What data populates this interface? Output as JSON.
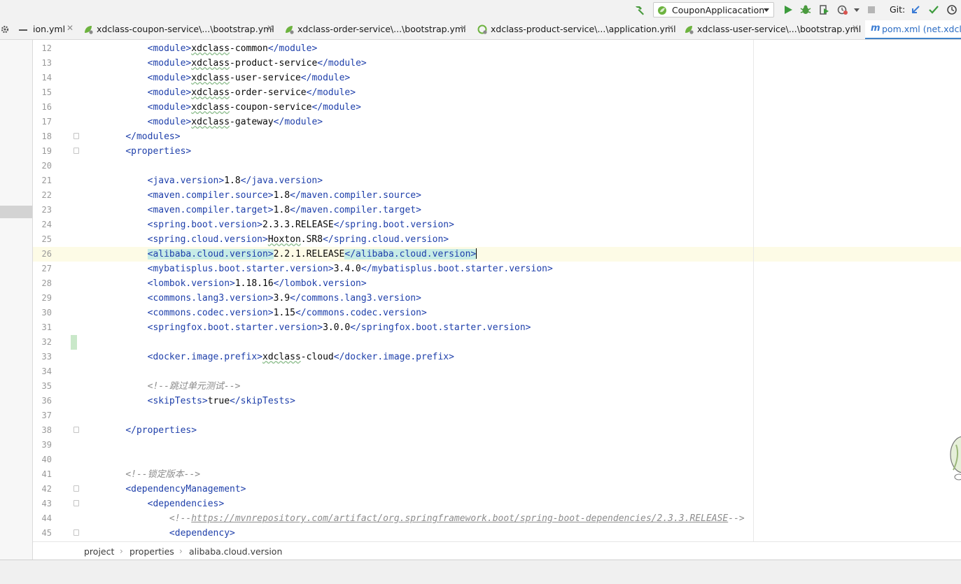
{
  "toolbar": {
    "run_config": "CouponApplicacation",
    "git_label": "Git:"
  },
  "tabs": [
    {
      "label": "ion.yml",
      "icon": "yaml-icon",
      "active": false
    },
    {
      "label": "xdclass-coupon-service\\...\\bootstrap.yml",
      "icon": "spring-leaf-icon",
      "active": false
    },
    {
      "label": "xdclass-order-service\\...\\bootstrap.yml",
      "icon": "spring-leaf-icon",
      "active": false
    },
    {
      "label": "xdclass-product-service\\...\\application.yml",
      "icon": "spring-boot-icon",
      "active": false
    },
    {
      "label": "xdclass-user-service\\...\\bootstrap.yml",
      "icon": "spring-leaf-icon",
      "active": false
    },
    {
      "label": "pom.xml (net.xdcla",
      "icon": "maven-icon",
      "active": true
    }
  ],
  "editor": {
    "lines": [
      {
        "n": "12",
        "indent": "        ",
        "parts": [
          [
            "tag",
            "<module>"
          ],
          [
            "sq",
            "xdclass"
          ],
          [
            "t",
            "-common"
          ],
          [
            "tag",
            "</module>"
          ]
        ]
      },
      {
        "n": "13",
        "indent": "        ",
        "parts": [
          [
            "tag",
            "<module>"
          ],
          [
            "sq",
            "xdclass"
          ],
          [
            "t",
            "-product-service"
          ],
          [
            "tag",
            "</module>"
          ]
        ]
      },
      {
        "n": "14",
        "indent": "        ",
        "parts": [
          [
            "tag",
            "<module>"
          ],
          [
            "sq",
            "xdclass"
          ],
          [
            "t",
            "-user-service"
          ],
          [
            "tag",
            "</module>"
          ]
        ]
      },
      {
        "n": "15",
        "indent": "        ",
        "parts": [
          [
            "tag",
            "<module>"
          ],
          [
            "sq",
            "xdclass"
          ],
          [
            "t",
            "-order-service"
          ],
          [
            "tag",
            "</module>"
          ]
        ]
      },
      {
        "n": "16",
        "indent": "        ",
        "parts": [
          [
            "tag",
            "<module>"
          ],
          [
            "sq",
            "xdclass"
          ],
          [
            "t",
            "-coupon-service"
          ],
          [
            "tag",
            "</module>"
          ]
        ]
      },
      {
        "n": "17",
        "indent": "        ",
        "parts": [
          [
            "tag",
            "<module>"
          ],
          [
            "sq",
            "xdclass"
          ],
          [
            "t",
            "-gateway"
          ],
          [
            "tag",
            "</module>"
          ]
        ]
      },
      {
        "n": "18",
        "indent": "    ",
        "parts": [
          [
            "tag",
            "</modules>"
          ]
        ],
        "fold": true
      },
      {
        "n": "19",
        "indent": "    ",
        "parts": [
          [
            "tag",
            "<properties>"
          ]
        ],
        "fold": true
      },
      {
        "n": "20",
        "indent": "",
        "parts": []
      },
      {
        "n": "21",
        "indent": "        ",
        "parts": [
          [
            "tag",
            "<java.version>"
          ],
          [
            "t",
            "1.8"
          ],
          [
            "tag",
            "</java.version>"
          ]
        ]
      },
      {
        "n": "22",
        "indent": "        ",
        "parts": [
          [
            "tag",
            "<maven.compiler.source>"
          ],
          [
            "t",
            "1.8"
          ],
          [
            "tag",
            "</maven.compiler.source>"
          ]
        ]
      },
      {
        "n": "23",
        "indent": "        ",
        "parts": [
          [
            "tag",
            "<maven.compiler.target>"
          ],
          [
            "t",
            "1.8"
          ],
          [
            "tag",
            "</maven.compiler.target>"
          ]
        ]
      },
      {
        "n": "24",
        "indent": "        ",
        "parts": [
          [
            "tag",
            "<spring.boot.version>"
          ],
          [
            "t",
            "2.3.3.RELEASE"
          ],
          [
            "tag",
            "</spring.boot.version>"
          ]
        ]
      },
      {
        "n": "25",
        "indent": "        ",
        "parts": [
          [
            "tag",
            "<spring.cloud.version>"
          ],
          [
            "sq",
            "Hoxton"
          ],
          [
            "t",
            ".SR8"
          ],
          [
            "tag",
            "</spring.cloud.version>"
          ]
        ]
      },
      {
        "n": "26",
        "indent": "        ",
        "parts": [
          [
            "hltag",
            "<alibaba.cloud.version>"
          ],
          [
            "t",
            "2.2.1.RELEASE"
          ],
          [
            "hltag",
            "</alibaba.cloud.version>"
          ],
          [
            "caret",
            ""
          ]
        ],
        "current": true
      },
      {
        "n": "27",
        "indent": "        ",
        "parts": [
          [
            "tag",
            "<mybatisplus.boot.starter.version>"
          ],
          [
            "t",
            "3.4.0"
          ],
          [
            "tag",
            "</mybatisplus.boot.starter.version>"
          ]
        ]
      },
      {
        "n": "28",
        "indent": "        ",
        "parts": [
          [
            "tag",
            "<lombok.version>"
          ],
          [
            "t",
            "1.18.16"
          ],
          [
            "tag",
            "</lombok.version>"
          ]
        ]
      },
      {
        "n": "29",
        "indent": "        ",
        "parts": [
          [
            "tag",
            "<commons.lang3.version>"
          ],
          [
            "t",
            "3.9"
          ],
          [
            "tag",
            "</commons.lang3.version>"
          ]
        ]
      },
      {
        "n": "30",
        "indent": "        ",
        "parts": [
          [
            "tag",
            "<commons.codec.version>"
          ],
          [
            "t",
            "1.15"
          ],
          [
            "tag",
            "</commons.codec.version>"
          ]
        ]
      },
      {
        "n": "31",
        "indent": "        ",
        "parts": [
          [
            "tag",
            "<springfox.boot.starter.version>"
          ],
          [
            "t",
            "3.0.0"
          ],
          [
            "tag",
            "</springfox.boot.starter.version>"
          ]
        ]
      },
      {
        "n": "32",
        "indent": "",
        "parts": [],
        "changed": true
      },
      {
        "n": "33",
        "indent": "        ",
        "parts": [
          [
            "tag",
            "<docker.image.prefix>"
          ],
          [
            "sq",
            "xdclass"
          ],
          [
            "t",
            "-cloud"
          ],
          [
            "tag",
            "</docker.image.prefix>"
          ]
        ]
      },
      {
        "n": "34",
        "indent": "",
        "parts": []
      },
      {
        "n": "35",
        "indent": "        ",
        "parts": [
          [
            "cmt",
            "<!--跳过单元测试-->"
          ]
        ]
      },
      {
        "n": "36",
        "indent": "        ",
        "parts": [
          [
            "tag",
            "<skipTests>"
          ],
          [
            "t",
            "true"
          ],
          [
            "tag",
            "</skipTests>"
          ]
        ]
      },
      {
        "n": "37",
        "indent": "",
        "parts": []
      },
      {
        "n": "38",
        "indent": "    ",
        "parts": [
          [
            "tag",
            "</properties>"
          ]
        ],
        "fold": true
      },
      {
        "n": "39",
        "indent": "",
        "parts": []
      },
      {
        "n": "40",
        "indent": "",
        "parts": []
      },
      {
        "n": "41",
        "indent": "    ",
        "parts": [
          [
            "cmt",
            "<!--锁定版本-->"
          ]
        ]
      },
      {
        "n": "42",
        "indent": "    ",
        "parts": [
          [
            "tag",
            "<dependencyManagement>"
          ]
        ],
        "fold": true
      },
      {
        "n": "43",
        "indent": "        ",
        "parts": [
          [
            "tag",
            "<dependencies>"
          ]
        ],
        "fold": true
      },
      {
        "n": "44",
        "indent": "            ",
        "parts": [
          [
            "cmt",
            "<!--"
          ],
          [
            "lnk",
            "https://mvnrepository.com/artifact/org.springframework.boot/spring-boot-dependencies/2.3.3.RELEASE"
          ],
          [
            "cmt",
            "-->"
          ]
        ]
      },
      {
        "n": "45",
        "indent": "            ",
        "parts": [
          [
            "tag",
            "<dependency>"
          ]
        ],
        "fold": true
      }
    ]
  },
  "breadcrumb": [
    "project",
    "properties",
    "alibaba.cloud.version"
  ],
  "colors": {
    "tag": "#1e3faa",
    "comment": "#8c8c8c",
    "current_line": "#fdfbe6",
    "active_tab_text": "#2a6bc3",
    "run_green": "#3c9b3c"
  }
}
